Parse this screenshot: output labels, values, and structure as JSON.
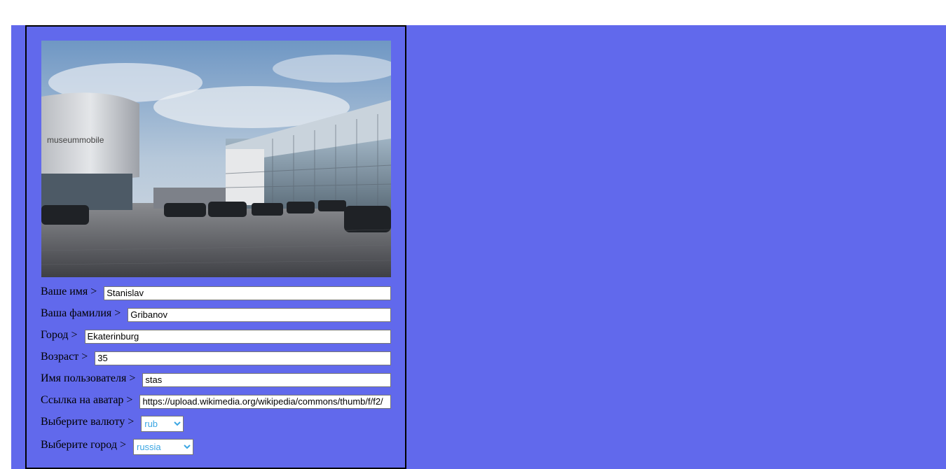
{
  "photo": {
    "alt": "museum mobile"
  },
  "form": {
    "name": {
      "label": "Ваше имя >",
      "value": "Stanislav"
    },
    "surname": {
      "label": "Ваша фамилия >",
      "value": "Gribanov"
    },
    "city": {
      "label": "Город >",
      "value": "Ekaterinburg"
    },
    "age": {
      "label": "Возраст >",
      "value": "35"
    },
    "username": {
      "label": "Имя пользователя >",
      "value": "stas"
    },
    "avatar": {
      "label": "Ссылка на аватар >",
      "value": "https://upload.wikimedia.org/wikipedia/commons/thumb/f/f2/"
    },
    "currency": {
      "label": "Выберите валюту >",
      "selected": "rub"
    },
    "country": {
      "label": "Выберите город >",
      "selected": "russia"
    }
  },
  "colors": {
    "panel": "#6169ec",
    "select_text": "#3ba6e3"
  }
}
